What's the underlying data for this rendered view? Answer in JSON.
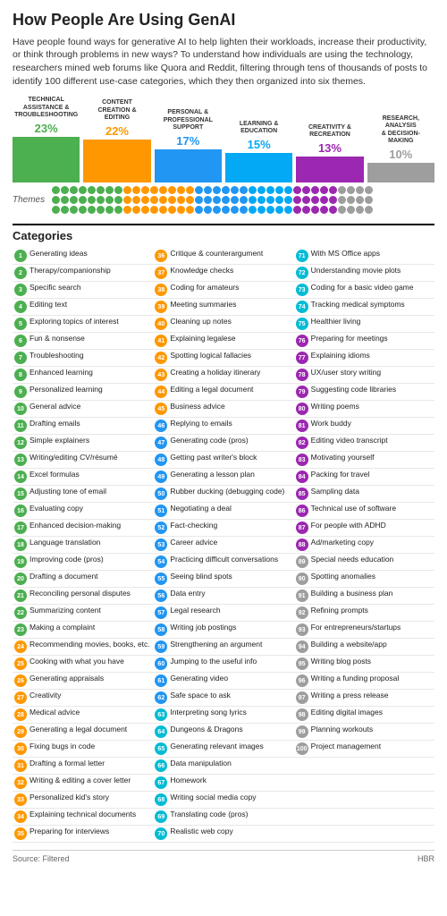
{
  "title": "How People Are Using GenAI",
  "intro": "Have people found ways for generative AI to help lighten their workloads, increase their productivity, or think through problems in new ways? To understand how individuals are using the technology, researchers mined web forums like Quora and Reddit, filtering through tens of thousands of posts to identify 100 different use-case categories, which they then organized into six themes.",
  "themes": [
    {
      "label": "Technical Assistance & Troubleshooting",
      "pct": 23,
      "color": "#4CAF50",
      "count": 23
    },
    {
      "label": "Content Creation & Editing",
      "pct": 22,
      "color": "#FF9800",
      "count": 22
    },
    {
      "label": "Personal & Professional Support",
      "pct": 17,
      "color": "#2196F3",
      "count": 17
    },
    {
      "label": "Learning & Education",
      "pct": 15,
      "color": "#03A9F4",
      "count": 15
    },
    {
      "label": "Creativity & Recreation",
      "pct": 13,
      "color": "#9C27B0",
      "count": 13
    },
    {
      "label": "Research, Analysis & Decision-Making",
      "pct": 10,
      "color": "#9E9E9E",
      "count": 10
    }
  ],
  "categories_title": "Categories",
  "categories": [
    {
      "n": 1,
      "text": "Generating ideas"
    },
    {
      "n": 2,
      "text": "Therapy/companionship"
    },
    {
      "n": 3,
      "text": "Specific search"
    },
    {
      "n": 4,
      "text": "Editing text"
    },
    {
      "n": 5,
      "text": "Exploring topics of interest"
    },
    {
      "n": 6,
      "text": "Fun & nonsense"
    },
    {
      "n": 7,
      "text": "Troubleshooting"
    },
    {
      "n": 8,
      "text": "Enhanced learning"
    },
    {
      "n": 9,
      "text": "Personalized learning"
    },
    {
      "n": 10,
      "text": "General advice"
    },
    {
      "n": 11,
      "text": "Drafting emails"
    },
    {
      "n": 12,
      "text": "Simple explainers"
    },
    {
      "n": 13,
      "text": "Writing/editing CV/résumé"
    },
    {
      "n": 14,
      "text": "Excel formulas"
    },
    {
      "n": 15,
      "text": "Adjusting tone of email"
    },
    {
      "n": 16,
      "text": "Evaluating copy"
    },
    {
      "n": 17,
      "text": "Enhanced decision-making"
    },
    {
      "n": 18,
      "text": "Language translation"
    },
    {
      "n": 19,
      "text": "Improving code (pros)"
    },
    {
      "n": 20,
      "text": "Drafting a document"
    },
    {
      "n": 21,
      "text": "Reconciling personal disputes"
    },
    {
      "n": 22,
      "text": "Summarizing content"
    },
    {
      "n": 23,
      "text": "Making a complaint"
    },
    {
      "n": 24,
      "text": "Recommending movies, books, etc."
    },
    {
      "n": 25,
      "text": "Cooking with what you have"
    },
    {
      "n": 26,
      "text": "Generating appraisals"
    },
    {
      "n": 27,
      "text": "Creativity"
    },
    {
      "n": 28,
      "text": "Medical advice"
    },
    {
      "n": 29,
      "text": "Generating a legal document"
    },
    {
      "n": 30,
      "text": "Fixing bugs in code"
    },
    {
      "n": 31,
      "text": "Drafting a formal letter"
    },
    {
      "n": 32,
      "text": "Writing & editing a cover letter"
    },
    {
      "n": 33,
      "text": "Personalized kid's story"
    },
    {
      "n": 34,
      "text": "Explaining technical documents"
    },
    {
      "n": 35,
      "text": "Preparing for interviews"
    },
    {
      "n": 36,
      "text": "Critique & counterargument"
    },
    {
      "n": 37,
      "text": "Knowledge checks"
    },
    {
      "n": 38,
      "text": "Coding for amateurs"
    },
    {
      "n": 39,
      "text": "Meeting summaries"
    },
    {
      "n": 40,
      "text": "Cleaning up notes"
    },
    {
      "n": 41,
      "text": "Explaining legalese"
    },
    {
      "n": 42,
      "text": "Spotting logical fallacies"
    },
    {
      "n": 43,
      "text": "Creating a holiday itinerary"
    },
    {
      "n": 44,
      "text": "Editing a legal document"
    },
    {
      "n": 45,
      "text": "Business advice"
    },
    {
      "n": 46,
      "text": "Replying to emails"
    },
    {
      "n": 47,
      "text": "Generating code (pros)"
    },
    {
      "n": 48,
      "text": "Getting past writer's block"
    },
    {
      "n": 49,
      "text": "Generating a lesson plan"
    },
    {
      "n": 50,
      "text": "Rubber ducking (debugging code)"
    },
    {
      "n": 51,
      "text": "Negotiating a deal"
    },
    {
      "n": 52,
      "text": "Fact-checking"
    },
    {
      "n": 53,
      "text": "Career advice"
    },
    {
      "n": 54,
      "text": "Practicing difficult conversations"
    },
    {
      "n": 55,
      "text": "Seeing blind spots"
    },
    {
      "n": 56,
      "text": "Data entry"
    },
    {
      "n": 57,
      "text": "Legal research"
    },
    {
      "n": 58,
      "text": "Writing job postings"
    },
    {
      "n": 59,
      "text": "Strengthening an argument"
    },
    {
      "n": 60,
      "text": "Jumping to the useful info"
    },
    {
      "n": 61,
      "text": "Generating video"
    },
    {
      "n": 62,
      "text": "Safe space to ask"
    },
    {
      "n": 63,
      "text": "Interpreting song lyrics"
    },
    {
      "n": 64,
      "text": "Dungeons & Dragons"
    },
    {
      "n": 65,
      "text": "Generating relevant images"
    },
    {
      "n": 66,
      "text": "Data manipulation"
    },
    {
      "n": 67,
      "text": "Homework"
    },
    {
      "n": 68,
      "text": "Writing social media copy"
    },
    {
      "n": 69,
      "text": "Translating code (pros)"
    },
    {
      "n": 70,
      "text": "Realistic web copy"
    },
    {
      "n": 71,
      "text": "With MS Office apps"
    },
    {
      "n": 72,
      "text": "Understanding movie plots"
    },
    {
      "n": 73,
      "text": "Coding for a basic video game"
    },
    {
      "n": 74,
      "text": "Tracking medical symptoms"
    },
    {
      "n": 75,
      "text": "Healthier living"
    },
    {
      "n": 76,
      "text": "Preparing for meetings"
    },
    {
      "n": 77,
      "text": "Explaining idioms"
    },
    {
      "n": 78,
      "text": "UX/user story writing"
    },
    {
      "n": 79,
      "text": "Suggesting code libraries"
    },
    {
      "n": 80,
      "text": "Writing poems"
    },
    {
      "n": 81,
      "text": "Work buddy"
    },
    {
      "n": 82,
      "text": "Editing video transcript"
    },
    {
      "n": 83,
      "text": "Motivating yourself"
    },
    {
      "n": 84,
      "text": "Packing for travel"
    },
    {
      "n": 85,
      "text": "Sampling data"
    },
    {
      "n": 86,
      "text": "Technical use of software"
    },
    {
      "n": 87,
      "text": "For people with ADHD"
    },
    {
      "n": 88,
      "text": "Ad/marketing copy"
    },
    {
      "n": 89,
      "text": "Special needs education"
    },
    {
      "n": 90,
      "text": "Spotting anomalies"
    },
    {
      "n": 91,
      "text": "Building a business plan"
    },
    {
      "n": 92,
      "text": "Refining prompts"
    },
    {
      "n": 93,
      "text": "For entrepreneurs/startups"
    },
    {
      "n": 94,
      "text": "Building a website/app"
    },
    {
      "n": 95,
      "text": "Writing blog posts"
    },
    {
      "n": 96,
      "text": "Writing a funding proposal"
    },
    {
      "n": 97,
      "text": "Writing a press release"
    },
    {
      "n": 98,
      "text": "Editing digital images"
    },
    {
      "n": 99,
      "text": "Planning workouts"
    },
    {
      "n": 100,
      "text": "Project management"
    }
  ],
  "footer": {
    "source": "Source: Filtered",
    "brand": "HBR"
  }
}
